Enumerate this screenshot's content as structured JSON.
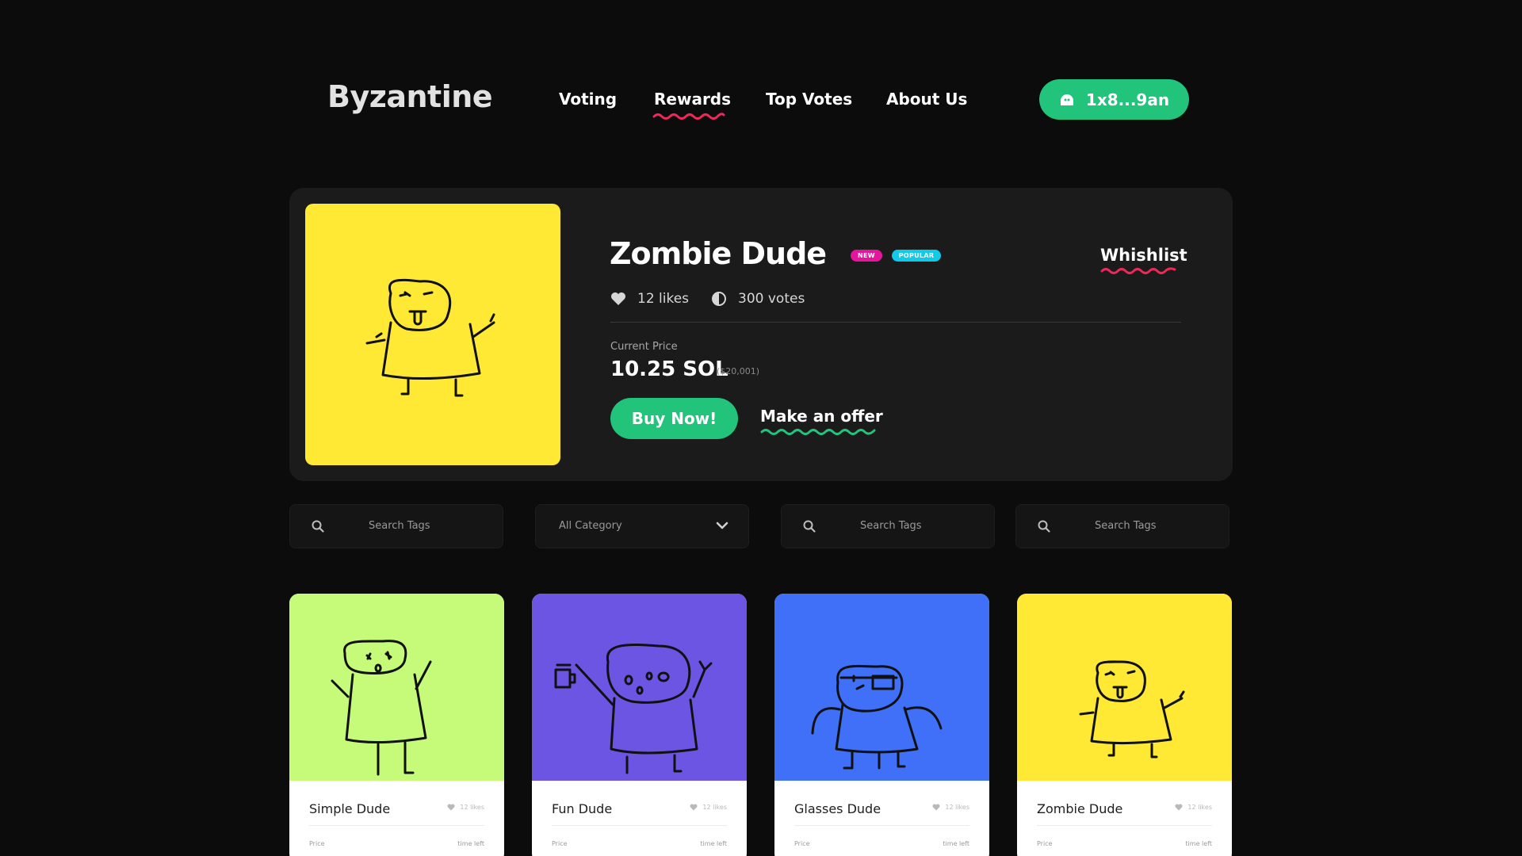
{
  "brand": {
    "logo": "Byzantine"
  },
  "nav": {
    "links": [
      "Voting",
      "Rewards",
      "Top Votes",
      "About Us"
    ],
    "active": "Rewards",
    "wallet_label": "1x8...9an"
  },
  "hero": {
    "title": "Zombie Dude",
    "badges": [
      "NEW",
      "POPULAR"
    ],
    "wishlist_label": "Whishlist",
    "likes": "12 likes",
    "votes": "300 votes",
    "current_price_label": "Current Price",
    "price": "10.25 SOL",
    "price_usd": "($20,001)",
    "buy_label": "Buy Now!",
    "offer_label": "Make an offer",
    "image_color": "#ffe935"
  },
  "filters": [
    {
      "type": "search",
      "placeholder": "Search Tags"
    },
    {
      "type": "select",
      "value": "All Category"
    },
    {
      "type": "search",
      "placeholder": "Search Tags"
    },
    {
      "type": "search",
      "placeholder": "Search Tags"
    }
  ],
  "cards": [
    {
      "name": "Simple Dude",
      "likes": "12 likes",
      "price_label": "Price",
      "time_label": "time left",
      "color": "#c6fb7a",
      "icon": "simple-dude-drawing"
    },
    {
      "name": "Fun Dude",
      "likes": "12 likes",
      "price_label": "Price",
      "time_label": "time left",
      "color": "#6c55e2",
      "icon": "fun-dude-drawing"
    },
    {
      "name": "Glasses Dude",
      "likes": "12 likes",
      "price_label": "Price",
      "time_label": "time left",
      "color": "#4070f7",
      "icon": "glasses-dude-drawing"
    },
    {
      "name": "Zombie Dude",
      "likes": "12 likes",
      "price_label": "Price",
      "time_label": "time left",
      "color": "#ffe935",
      "icon": "zombie-dude-drawing"
    }
  ],
  "colors": {
    "accent_green": "#22c37a",
    "accent_pink": "#f0285a",
    "badge_new": "#e4169e",
    "badge_popular": "#11c9e8",
    "price_purple": "#7b2ff7"
  }
}
